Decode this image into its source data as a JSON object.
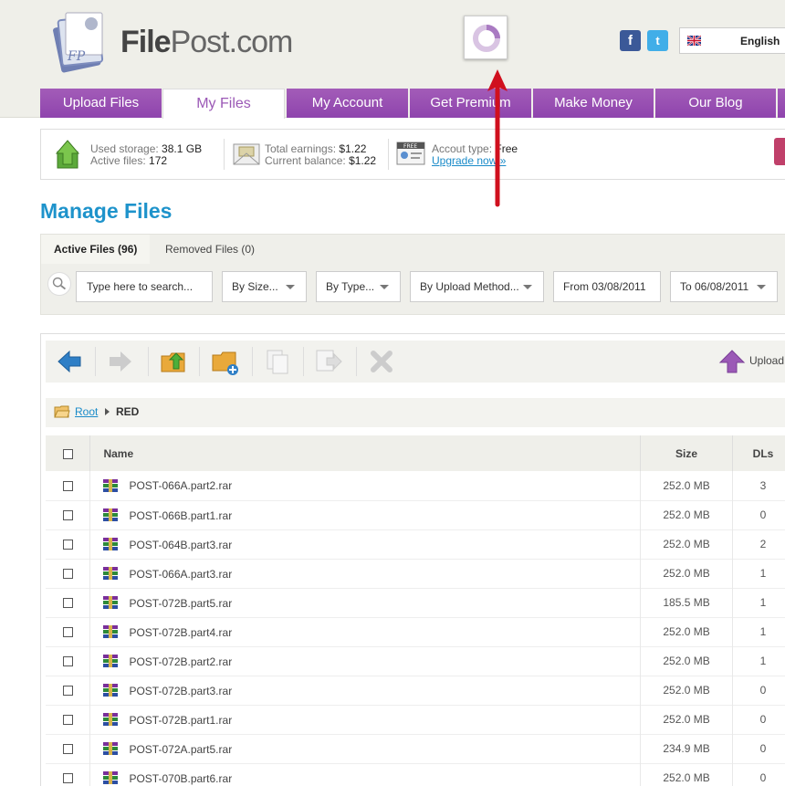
{
  "header": {
    "brand_bold": "File",
    "brand_light": "Post",
    "brand_tld": ".com",
    "language": "English"
  },
  "nav": {
    "tabs": [
      {
        "label": "Upload Files",
        "active": false
      },
      {
        "label": "My Files",
        "active": true
      },
      {
        "label": "My Account",
        "active": false
      },
      {
        "label": "Get Premium",
        "active": false
      },
      {
        "label": "Make Money",
        "active": false
      },
      {
        "label": "Our Blog",
        "active": false
      }
    ]
  },
  "stats": {
    "used_storage_label": "Used storage: ",
    "used_storage_value": "38.1 GB",
    "active_files_label": "Active files: ",
    "active_files_value": "172",
    "total_earnings_label": "Total earnings: ",
    "total_earnings_value": "$1.22",
    "current_balance_label": "Current balance: ",
    "current_balance_value": "$1.22",
    "account_type_label": "Accout type: ",
    "account_type_value": "Free",
    "upgrade_link": "Upgrade now »",
    "free_badge": "FREE"
  },
  "manage": {
    "title": "Manage Files",
    "tabs": [
      {
        "label": "Active Files (96)",
        "active": true
      },
      {
        "label": "Removed Files (0)",
        "active": false
      }
    ],
    "search_placeholder": "Type here to search...",
    "filters": {
      "size": "By Size...",
      "type": "By Type...",
      "upload_method": "By Upload Method...",
      "from_date": "From 03/08/2011",
      "to_date": "To 06/08/2011"
    }
  },
  "toolbar": {
    "upload_label": "Upload"
  },
  "breadcrumb": {
    "root": "Root",
    "current": "RED"
  },
  "table": {
    "columns": {
      "name": "Name",
      "size": "Size",
      "dls": "DLs"
    },
    "rows": [
      {
        "name": "POST-066A.part2.rar",
        "size": "252.0 MB",
        "dls": "3"
      },
      {
        "name": "POST-066B.part1.rar",
        "size": "252.0 MB",
        "dls": "0"
      },
      {
        "name": "POST-064B.part3.rar",
        "size": "252.0 MB",
        "dls": "2"
      },
      {
        "name": "POST-066A.part3.rar",
        "size": "252.0 MB",
        "dls": "1"
      },
      {
        "name": "POST-072B.part5.rar",
        "size": "185.5 MB",
        "dls": "1"
      },
      {
        "name": "POST-072B.part4.rar",
        "size": "252.0 MB",
        "dls": "1"
      },
      {
        "name": "POST-072B.part2.rar",
        "size": "252.0 MB",
        "dls": "1"
      },
      {
        "name": "POST-072B.part3.rar",
        "size": "252.0 MB",
        "dls": "0"
      },
      {
        "name": "POST-072B.part1.rar",
        "size": "252.0 MB",
        "dls": "0"
      },
      {
        "name": "POST-072A.part5.rar",
        "size": "234.9 MB",
        "dls": "0"
      },
      {
        "name": "POST-070B.part6.rar",
        "size": "252.0 MB",
        "dls": "0"
      }
    ]
  },
  "colors": {
    "nav_purple": "#9b59b6",
    "title_blue": "#1e93cb",
    "link_blue": "#1a8bc9",
    "annotation_red": "#d0101e"
  }
}
